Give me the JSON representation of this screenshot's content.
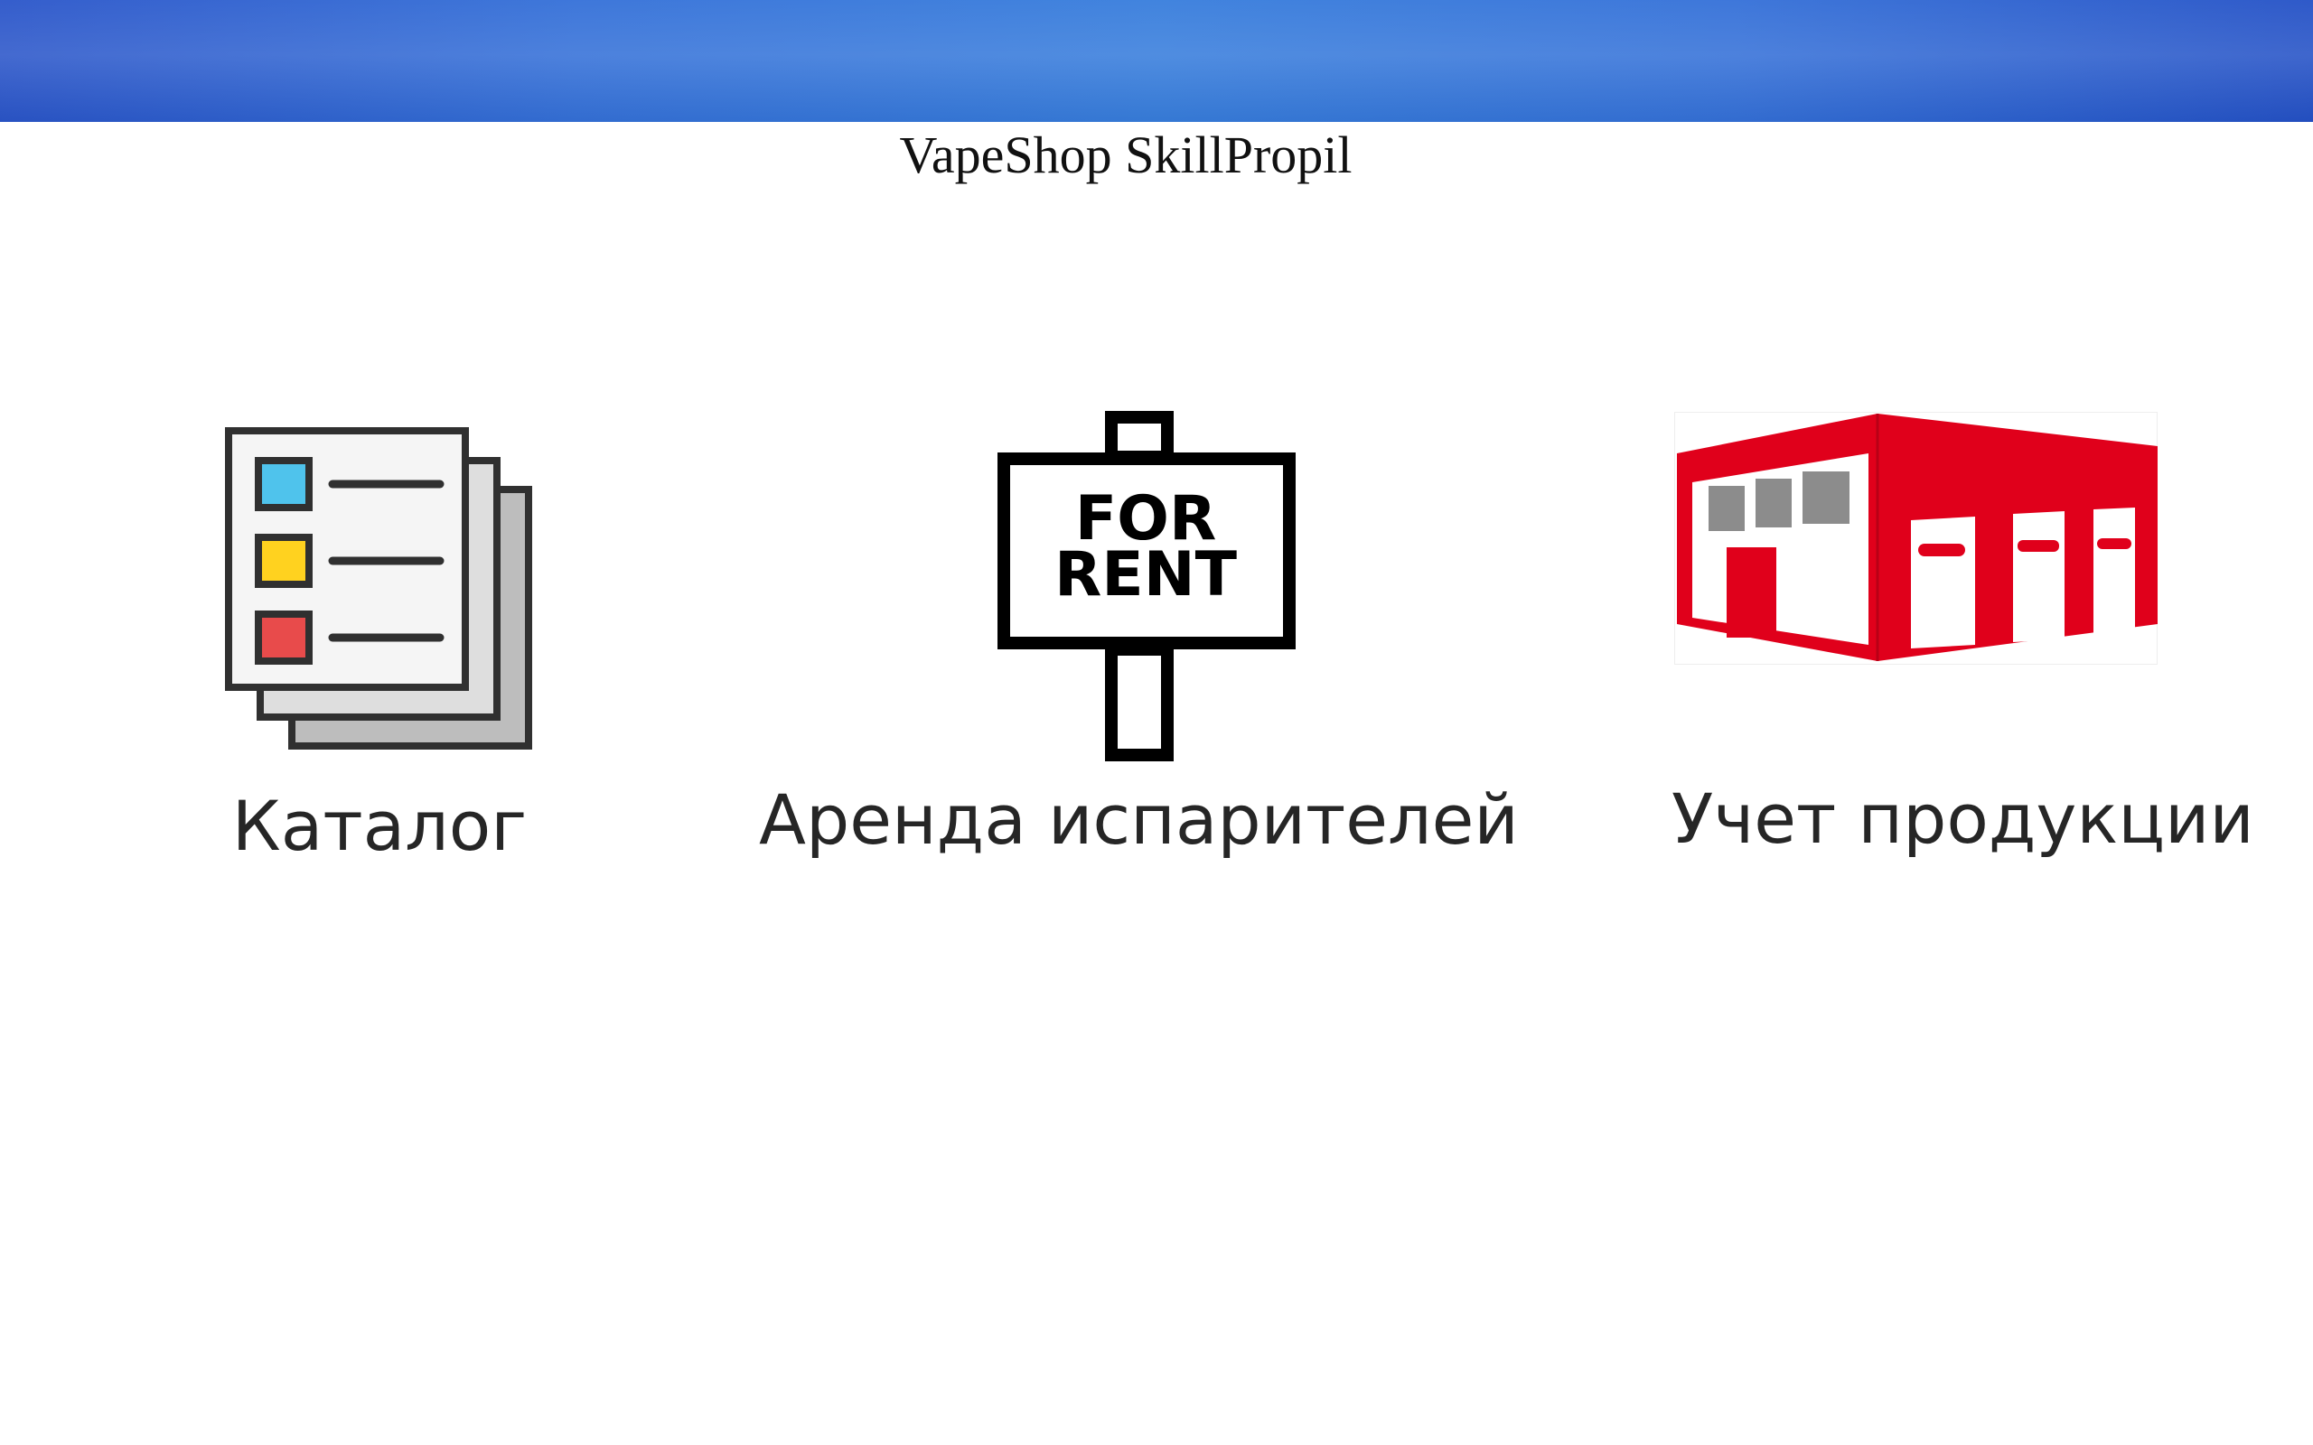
{
  "app": {
    "title": "VapeShop SkillPropil"
  },
  "colors": {
    "header_gradient_center": "#377ddc",
    "header_gradient_edge": "#2451c6",
    "background": "#ffffff",
    "label_text": "#262626",
    "catalog_marker_blue": "#4fc3ec",
    "catalog_marker_yellow": "#ffd21f",
    "catalog_marker_red": "#e84b4b",
    "warehouse_red": "#e0001b",
    "warehouse_window_gray": "#8c8c8c"
  },
  "menu": {
    "tiles": [
      {
        "label": "Каталог",
        "icon": "catalog-document-stack-icon"
      },
      {
        "label": "Аренда испарителей",
        "icon": "for-rent-sign-icon",
        "sign_line1": "FOR",
        "sign_line2": "RENT"
      },
      {
        "label": "Учет продукции",
        "icon": "warehouse-building-icon"
      }
    ]
  }
}
